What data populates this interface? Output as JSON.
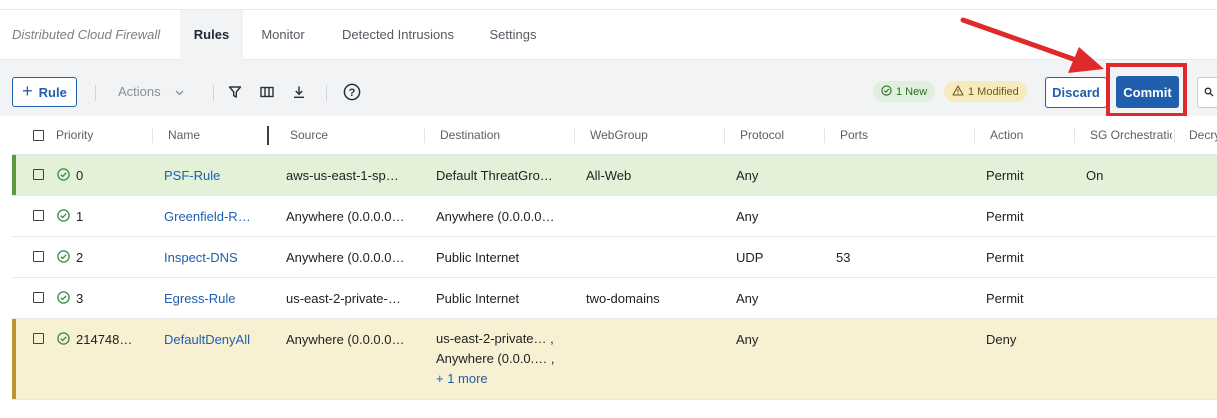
{
  "app_title": "Distributed Cloud Firewall",
  "tabs": [
    {
      "label": "Rules",
      "active": true
    },
    {
      "label": "Monitor",
      "active": false
    },
    {
      "label": "Detected Intrusions",
      "active": false
    },
    {
      "label": "Settings",
      "active": false
    }
  ],
  "toolbar": {
    "add_rule_label": "Rule",
    "actions_label": "Actions",
    "new_badge": "1 New",
    "modified_badge": "1 Modified",
    "discard_label": "Discard",
    "commit_label": "Commit"
  },
  "columns": [
    "Priority",
    "Name",
    "Source",
    "Destination",
    "WebGroup",
    "Protocol",
    "Ports",
    "Action",
    "SG Orchestration",
    "Decryption"
  ],
  "rows": [
    {
      "state": "new",
      "priority": "0",
      "name": "PSF-Rule",
      "source": "aws-us-east-1-sp…",
      "destination": "Default ThreatGro…",
      "webgroup": "All-Web",
      "protocol": "Any",
      "ports": "",
      "action": "Permit",
      "sg": "On"
    },
    {
      "state": "normal",
      "priority": "1",
      "name": "Greenfield-R…",
      "source": "Anywhere (0.0.0.0…",
      "destination": "Anywhere (0.0.0.0…",
      "webgroup": "",
      "protocol": "Any",
      "ports": "",
      "action": "Permit",
      "sg": ""
    },
    {
      "state": "normal",
      "priority": "2",
      "name": "Inspect-DNS",
      "source": "Anywhere (0.0.0.0…",
      "destination": "Public Internet",
      "webgroup": "",
      "protocol": "UDP",
      "ports": "53",
      "action": "Permit",
      "sg": ""
    },
    {
      "state": "normal",
      "priority": "3",
      "name": "Egress-Rule",
      "source": "us-east-2-private-…",
      "destination": "Public Internet",
      "webgroup": "two-domains",
      "protocol": "Any",
      "ports": "",
      "action": "Permit",
      "sg": ""
    },
    {
      "state": "modified",
      "priority": "214748…",
      "name": "DefaultDenyAll",
      "source": "Anywhere (0.0.0.0…",
      "destination_lines": [
        "us-east-2-private… ,",
        "Anywhere (0.0.0.… ,"
      ],
      "destination_more": "+ 1 more",
      "webgroup": "",
      "protocol": "Any",
      "ports": "",
      "action": "Deny",
      "sg": ""
    }
  ],
  "colors": {
    "accent": "#1f5fae",
    "highlight": "#e0292b",
    "new_row": "#e3f1d8",
    "modified_row": "#f8f0d2"
  }
}
